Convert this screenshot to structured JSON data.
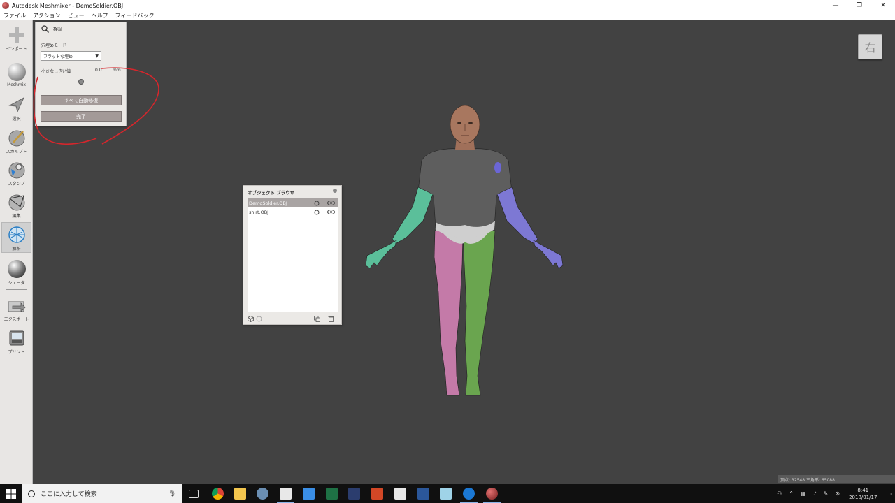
{
  "window": {
    "title": "Autodesk Meshmixer - DemoSoldier.OBJ",
    "controls": {
      "minimize": "—",
      "restore": "❐",
      "close": "✕"
    }
  },
  "menu": [
    "ファイル",
    "アクション",
    "ビュー",
    "ヘルプ",
    "フィードバック"
  ],
  "toolbar": [
    {
      "label": "インポート",
      "icon": "plus-icon"
    },
    {
      "label": "Meshmix",
      "icon": "meshmix-ball-icon"
    },
    {
      "label": "選択",
      "icon": "select-arrow-icon"
    },
    {
      "label": "スカルプト",
      "icon": "sculpt-brush-icon"
    },
    {
      "label": "スタンプ",
      "icon": "stamp-icon"
    },
    {
      "label": "編集",
      "icon": "edit-icon"
    },
    {
      "label": "解析",
      "icon": "analysis-icon",
      "active": true
    },
    {
      "label": "シェーダ",
      "icon": "shader-ball-icon"
    },
    {
      "label": "エクスポート",
      "icon": "export-icon"
    },
    {
      "label": "プリント",
      "icon": "print-icon"
    }
  ],
  "inspector": {
    "title": "検証",
    "hole_fill_mode_label": "穴埋めモード",
    "hole_fill_mode_value": "フラットな埋め",
    "threshold_label": "小さなしきい値",
    "threshold_value": "0.01",
    "threshold_unit": "mm",
    "threshold_slider_fraction": 0.5,
    "auto_repair_button": "すべて自動修復",
    "done_button": "完了"
  },
  "object_browser": {
    "title": "オブジェクト ブラウザ",
    "objects": [
      {
        "name": "DemoSoldier.OBJ",
        "selected": true
      },
      {
        "name": "shirt.OBJ",
        "selected": false
      }
    ]
  },
  "viewcube": {
    "face": "右"
  },
  "status": {
    "text": "頂点: 32548 三角形: 65088"
  },
  "taskbar": {
    "search_placeholder": "ここに入力して検索",
    "time": "8:41",
    "date": "2018/01/17"
  },
  "colors": {
    "viewport": "#424242",
    "button": "#a39a98",
    "annotation": "#d7262c",
    "shirt": "#5e5e5e",
    "left_arm": "#5bbf9a",
    "right_arm": "#7d78d4",
    "left_leg": "#c47aa8",
    "right_leg": "#6aa54f"
  }
}
